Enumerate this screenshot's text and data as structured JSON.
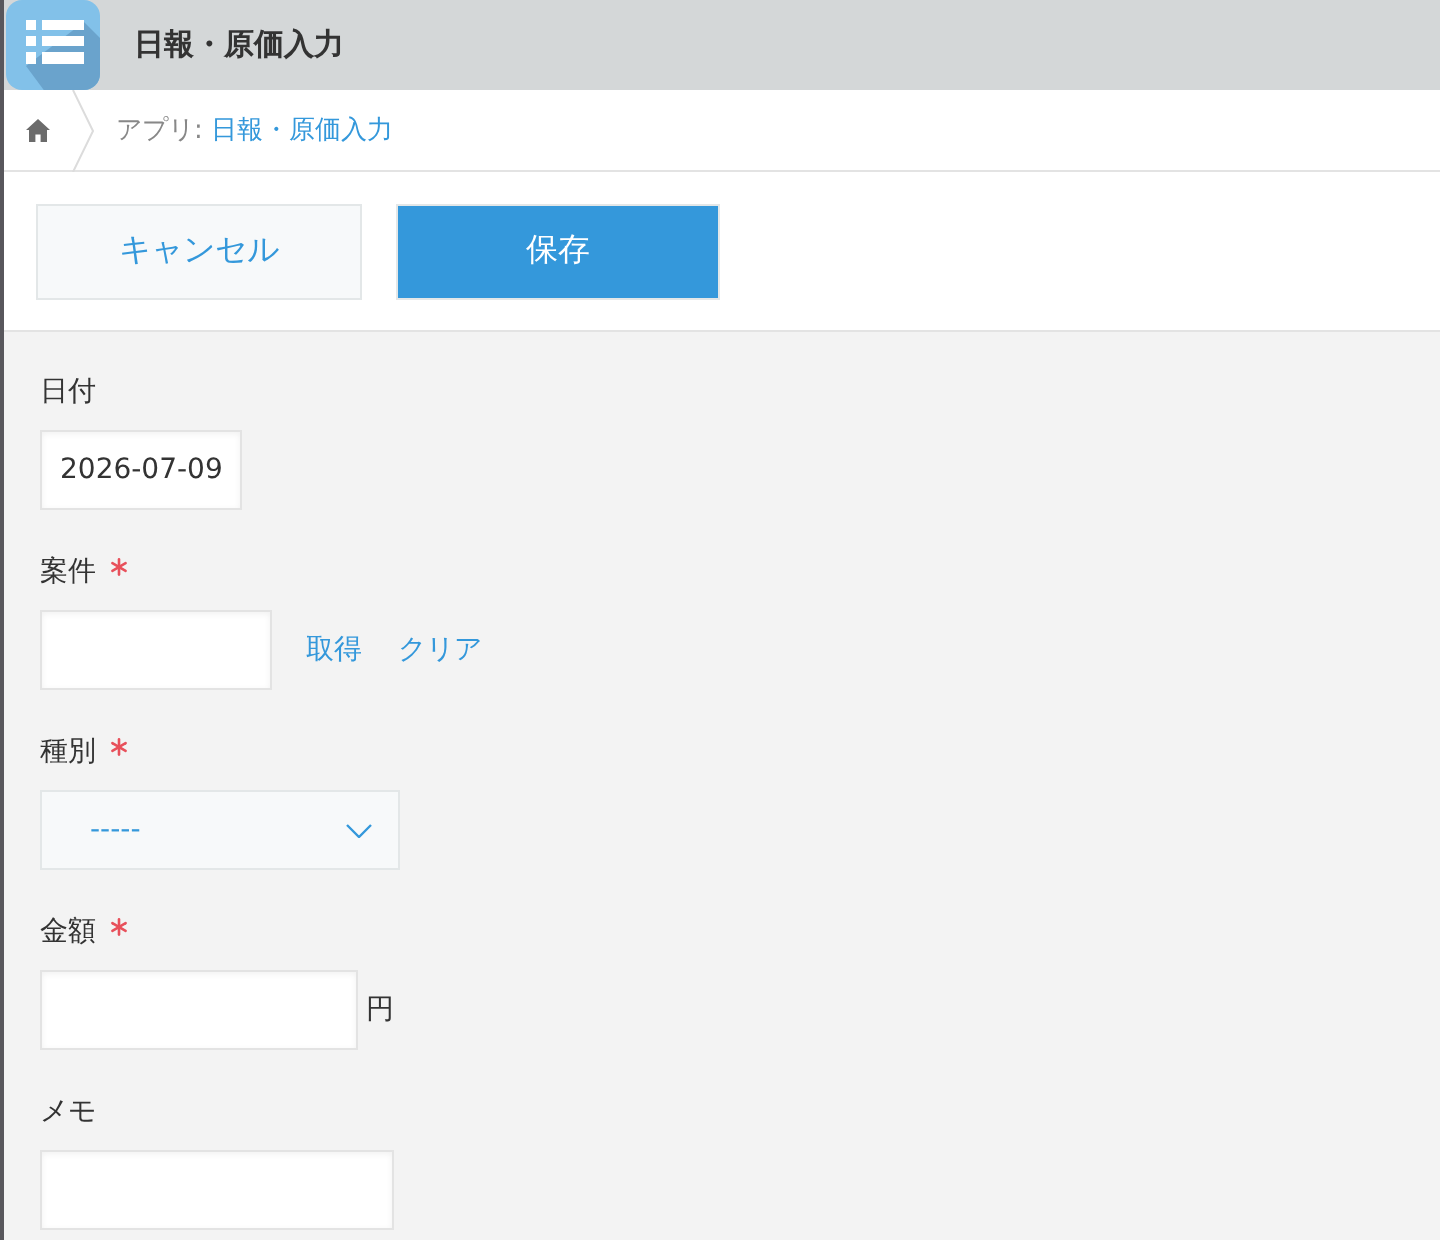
{
  "header": {
    "title": "日報・原価入力"
  },
  "breadcrumb": {
    "prefix": "アプリ:",
    "link": "日報・原価入力"
  },
  "buttons": [
    {
      "kind": "secondary",
      "label": "キャンセル"
    },
    {
      "kind": "primary",
      "label": "保存"
    }
  ],
  "fields": [
    {
      "kind": "date",
      "label": "日付",
      "required": false,
      "value": "2026-07-09"
    },
    {
      "kind": "lookup",
      "label": "案件",
      "required": true,
      "actions": [
        "取得",
        "クリア"
      ]
    },
    {
      "kind": "dropdown",
      "label": "種別",
      "required": true,
      "value": "-----"
    },
    {
      "kind": "number",
      "label": "金額",
      "required": true,
      "unit": "円"
    },
    {
      "kind": "text",
      "label": "メモ",
      "required": false
    }
  ]
}
